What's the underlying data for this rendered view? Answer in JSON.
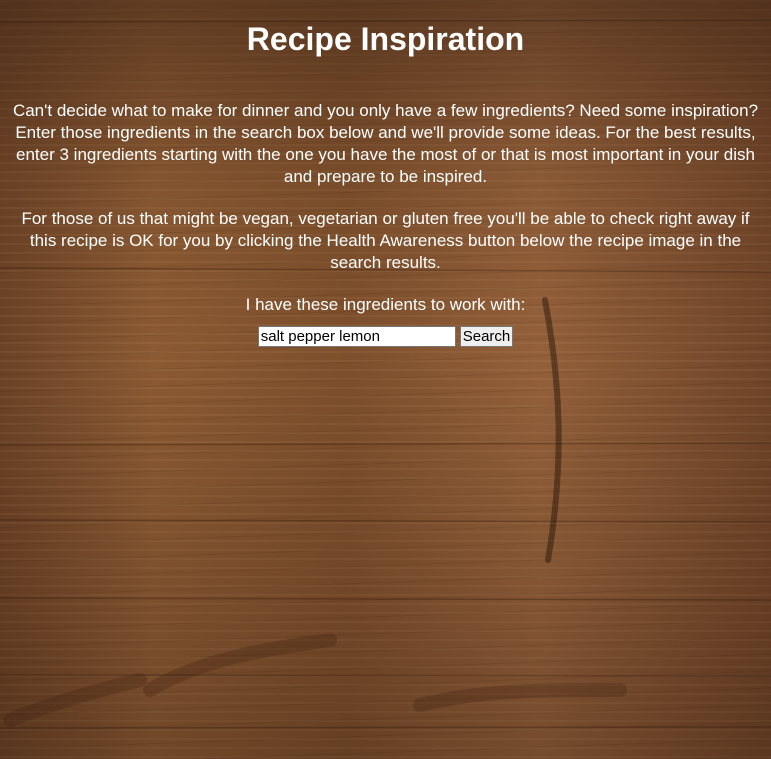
{
  "page": {
    "title": "Recipe Inspiration",
    "intro_paragraph": "Can't decide what to make for dinner and you only have a few ingredients? Need some inspiration? Enter those ingredients in the search box below and we'll provide some ideas. For the best results, enter 3 ingredients starting with the one you have the most of or that is most important in your dish and prepare to be inspired.",
    "health_paragraph": "For those of us that might be vegan, vegetarian or gluten free you'll be able to check right away if this recipe is OK for you by clicking the Health Awareness button below the recipe image in the search results."
  },
  "search": {
    "prompt": "I have these ingredients to work with:",
    "value": "salt pepper lemon",
    "button_label": "Search"
  },
  "colors": {
    "text": "#ffffff",
    "background_wood": "#8a5a32"
  }
}
